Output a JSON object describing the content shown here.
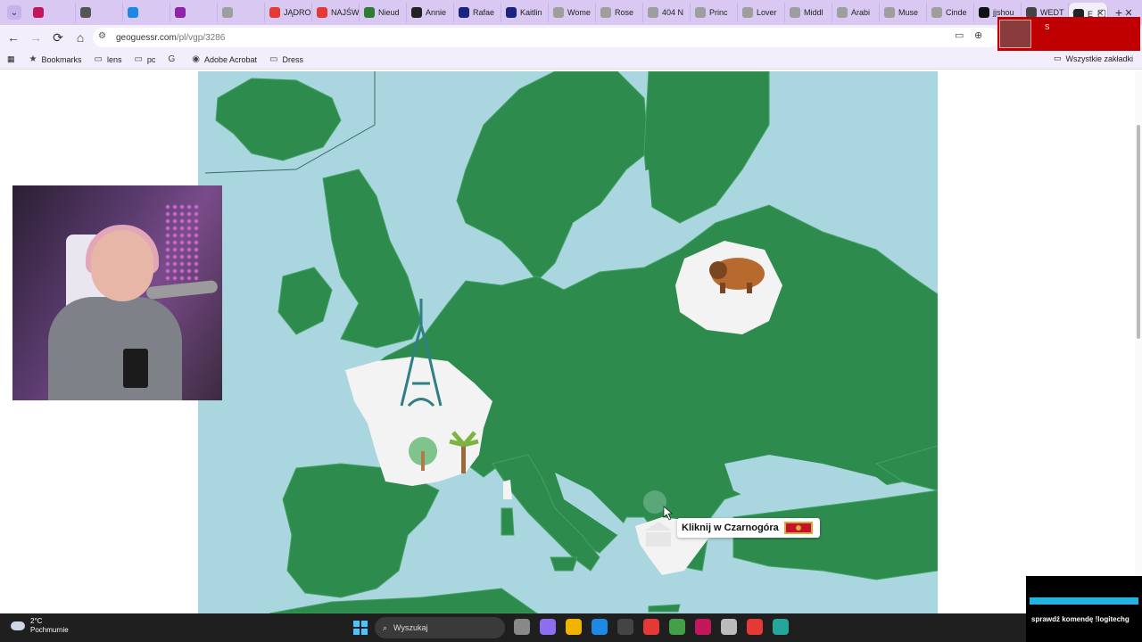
{
  "browser": {
    "tabs": [
      {
        "label": "",
        "favicon_color": "#c2185b"
      },
      {
        "label": "",
        "favicon_color": "#555555"
      },
      {
        "label": "",
        "favicon_color": "#1e88e5"
      },
      {
        "label": "",
        "favicon_color": "#8e24aa"
      },
      {
        "label": "",
        "favicon_color": "#9e9e9e"
      },
      {
        "label": "JĄDRO",
        "favicon_color": "#e53935"
      },
      {
        "label": "NAJŚW",
        "favicon_color": "#e53935"
      },
      {
        "label": "Nieud",
        "favicon_color": "#2e7d32"
      },
      {
        "label": "Annie",
        "favicon_color": "#222222"
      },
      {
        "label": "Rafae",
        "favicon_color": "#1a237e"
      },
      {
        "label": "Kaitlin",
        "favicon_color": "#1a237e"
      },
      {
        "label": "Wome",
        "favicon_color": "#9e9e9e"
      },
      {
        "label": "Rose",
        "favicon_color": "#9e9e9e"
      },
      {
        "label": "404 N",
        "favicon_color": "#9e9e9e"
      },
      {
        "label": "Princ",
        "favicon_color": "#9e9e9e"
      },
      {
        "label": "Lover",
        "favicon_color": "#9e9e9e"
      },
      {
        "label": "Middl",
        "favicon_color": "#9e9e9e"
      },
      {
        "label": "Arabi",
        "favicon_color": "#9e9e9e"
      },
      {
        "label": "Muse",
        "favicon_color": "#9e9e9e"
      },
      {
        "label": "Cinde",
        "favicon_color": "#9e9e9e"
      },
      {
        "label": "jjshou",
        "favicon_color": "#111111"
      },
      {
        "label": "WEDT",
        "favicon_color": "#444444"
      }
    ],
    "active_tab": {
      "label": "E"
    },
    "new_tab": "+",
    "window_controls": {
      "minimize": "–",
      "maximize": "▢",
      "close": "✕"
    },
    "nav": {
      "back": "←",
      "forward": "→",
      "reload": "⟳",
      "home": "⌂"
    },
    "url": {
      "domain": "geoguessr.com",
      "path": "/pl/vgp/3286"
    },
    "bookmarks": [
      {
        "label": "Bookmarks",
        "icon": "star-icon"
      },
      {
        "label": "lens",
        "icon": "folder-icon"
      },
      {
        "label": "pc",
        "icon": "folder-icon"
      },
      {
        "label": "",
        "icon": "google-icon"
      },
      {
        "label": "Adobe Acrobat",
        "icon": "acrobat-icon"
      },
      {
        "label": "Dress",
        "icon": "folder-icon"
      }
    ],
    "all_bookmarks": "Wszystkie zakładki"
  },
  "game": {
    "prompt_text": "Kliknij w Czarnogóra",
    "colors": {
      "sea": "#a9d6df",
      "land": "#2e8b4e",
      "border": "#41a262",
      "found": "#f3f3f3",
      "hover": "#5aa877"
    }
  },
  "stream_overlay": {
    "top_letter": "S",
    "bottom_text": "sprawdź komendę !logitechg"
  },
  "taskbar": {
    "weather_temp": "2°C",
    "weather_desc": "Pochmurnie",
    "search_placeholder": "Wyszukaj",
    "app_colors": [
      "#888888",
      "#8e6df0",
      "#f0b400",
      "#1e88e5",
      "#444444",
      "#e53935",
      "#43a047",
      "#c2185b",
      "#bbbbbb",
      "#e53935",
      "#26a69a"
    ]
  }
}
